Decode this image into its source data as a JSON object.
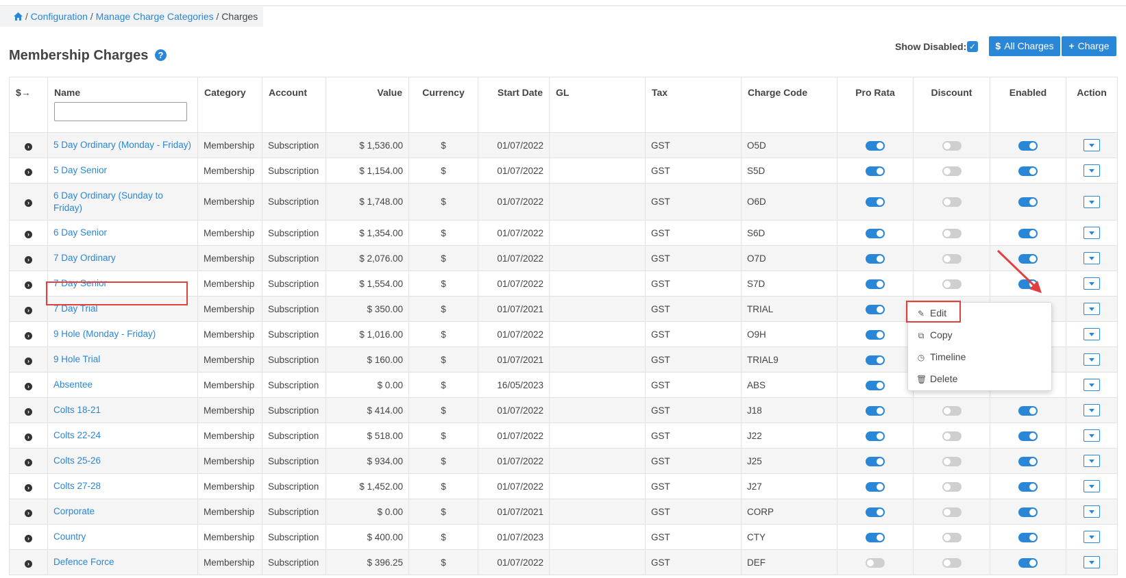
{
  "breadcrumb": {
    "items": [
      "Configuration",
      "Manage Charge Categories"
    ],
    "separator": "/",
    "current": "Charges"
  },
  "page": {
    "title": "Membership Charges",
    "help": "?"
  },
  "controls": {
    "show_disabled_label": "Show Disabled:",
    "show_disabled_checked": true,
    "all_charges_label": "All Charges",
    "all_charges_icon": "$",
    "add_charge_label": "Charge",
    "add_charge_icon": "+"
  },
  "table": {
    "columns": [
      "$→",
      "Name",
      "Category",
      "Account",
      "Value",
      "Currency",
      "Start Date",
      "GL",
      "Tax",
      "Charge Code",
      "Pro Rata",
      "Discount",
      "Enabled",
      "Action"
    ],
    "rows": [
      {
        "name": "5 Day Ordinary (Monday - Friday)",
        "category": "Membership",
        "account": "Subscription",
        "value": "$ 1,536.00",
        "currency": "$",
        "start_date": "01/07/2022",
        "gl": "",
        "tax": "GST",
        "code": "O5D",
        "pro_rata": true,
        "discount": false,
        "enabled": true
      },
      {
        "name": "5 Day Senior",
        "category": "Membership",
        "account": "Subscription",
        "value": "$ 1,154.00",
        "currency": "$",
        "start_date": "01/07/2022",
        "gl": "",
        "tax": "GST",
        "code": "S5D",
        "pro_rata": true,
        "discount": false,
        "enabled": true
      },
      {
        "name": "6 Day Ordinary (Sunday to Friday)",
        "category": "Membership",
        "account": "Subscription",
        "value": "$ 1,748.00",
        "currency": "$",
        "start_date": "01/07/2022",
        "gl": "",
        "tax": "GST",
        "code": "O6D",
        "pro_rata": true,
        "discount": false,
        "enabled": true
      },
      {
        "name": "6 Day Senior",
        "category": "Membership",
        "account": "Subscription",
        "value": "$ 1,354.00",
        "currency": "$",
        "start_date": "01/07/2022",
        "gl": "",
        "tax": "GST",
        "code": "S6D",
        "pro_rata": true,
        "discount": false,
        "enabled": true
      },
      {
        "name": "7 Day Ordinary",
        "category": "Membership",
        "account": "Subscription",
        "value": "$ 2,076.00",
        "currency": "$",
        "start_date": "01/07/2022",
        "gl": "",
        "tax": "GST",
        "code": "O7D",
        "pro_rata": true,
        "discount": false,
        "enabled": true
      },
      {
        "name": "7 Day Senior",
        "category": "Membership",
        "account": "Subscription",
        "value": "$ 1,554.00",
        "currency": "$",
        "start_date": "01/07/2022",
        "gl": "",
        "tax": "GST",
        "code": "S7D",
        "pro_rata": true,
        "discount": false,
        "enabled": true
      },
      {
        "name": "7 Day Trial",
        "category": "Membership",
        "account": "Subscription",
        "value": "$ 350.00",
        "currency": "$",
        "start_date": "01/07/2021",
        "gl": "",
        "tax": "GST",
        "code": "TRIAL",
        "pro_rata": true,
        "discount": false,
        "enabled": true
      },
      {
        "name": "9 Hole (Monday - Friday)",
        "category": "Membership",
        "account": "Subscription",
        "value": "$ 1,016.00",
        "currency": "$",
        "start_date": "01/07/2022",
        "gl": "",
        "tax": "GST",
        "code": "O9H",
        "pro_rata": true,
        "discount": false,
        "enabled": true
      },
      {
        "name": "9 Hole Trial",
        "category": "Membership",
        "account": "Subscription",
        "value": "$ 160.00",
        "currency": "$",
        "start_date": "01/07/2021",
        "gl": "",
        "tax": "GST",
        "code": "TRIAL9",
        "pro_rata": true,
        "discount": false,
        "enabled": true
      },
      {
        "name": "Absentee",
        "category": "Membership",
        "account": "Subscription",
        "value": "$ 0.00",
        "currency": "$",
        "start_date": "16/05/2023",
        "gl": "",
        "tax": "GST",
        "code": "ABS",
        "pro_rata": true,
        "discount": false,
        "enabled": true
      },
      {
        "name": "Colts 18-21",
        "category": "Membership",
        "account": "Subscription",
        "value": "$ 414.00",
        "currency": "$",
        "start_date": "01/07/2022",
        "gl": "",
        "tax": "GST",
        "code": "J18",
        "pro_rata": true,
        "discount": false,
        "enabled": true
      },
      {
        "name": "Colts 22-24",
        "category": "Membership",
        "account": "Subscription",
        "value": "$ 518.00",
        "currency": "$",
        "start_date": "01/07/2022",
        "gl": "",
        "tax": "GST",
        "code": "J22",
        "pro_rata": true,
        "discount": false,
        "enabled": true
      },
      {
        "name": "Colts 25-26",
        "category": "Membership",
        "account": "Subscription",
        "value": "$ 934.00",
        "currency": "$",
        "start_date": "01/07/2022",
        "gl": "",
        "tax": "GST",
        "code": "J25",
        "pro_rata": true,
        "discount": false,
        "enabled": true
      },
      {
        "name": "Colts 27-28",
        "category": "Membership",
        "account": "Subscription",
        "value": "$ 1,452.00",
        "currency": "$",
        "start_date": "01/07/2022",
        "gl": "",
        "tax": "GST",
        "code": "J27",
        "pro_rata": true,
        "discount": false,
        "enabled": true
      },
      {
        "name": "Corporate",
        "category": "Membership",
        "account": "Subscription",
        "value": "$ 0.00",
        "currency": "$",
        "start_date": "01/07/2021",
        "gl": "",
        "tax": "GST",
        "code": "CORP",
        "pro_rata": true,
        "discount": false,
        "enabled": true
      },
      {
        "name": "Country",
        "category": "Membership",
        "account": "Subscription",
        "value": "$ 400.00",
        "currency": "$",
        "start_date": "01/07/2023",
        "gl": "",
        "tax": "GST",
        "code": "CTY",
        "pro_rata": true,
        "discount": false,
        "enabled": true
      },
      {
        "name": "Defence Force",
        "category": "Membership",
        "account": "Subscription",
        "value": "$ 396.25",
        "currency": "$",
        "start_date": "01/07/2022",
        "gl": "",
        "tax": "GST",
        "code": "DEF",
        "pro_rata": false,
        "discount": false,
        "enabled": true
      }
    ]
  },
  "action_menu": {
    "items": [
      {
        "label": "Edit",
        "icon": "pencil-icon"
      },
      {
        "label": "Copy",
        "icon": "copy-icon"
      },
      {
        "label": "Timeline",
        "icon": "clock-icon"
      },
      {
        "label": "Delete",
        "icon": "trash-icon"
      }
    ]
  },
  "colors": {
    "accent": "#2a86d6",
    "highlight": "#e04040",
    "toggle_off": "#cfcfcf"
  }
}
